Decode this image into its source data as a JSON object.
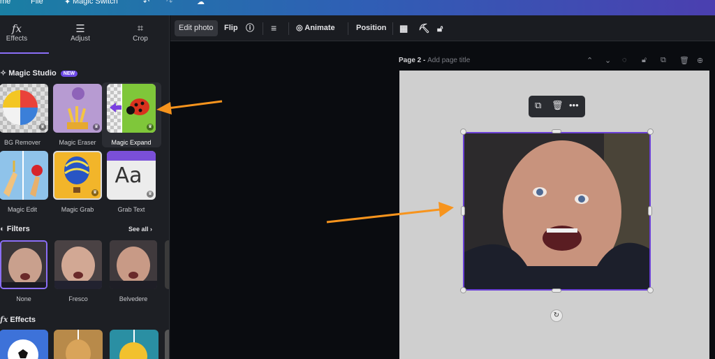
{
  "topbar": {
    "home": "me",
    "file": "File",
    "magic_switch": "Magic Switch"
  },
  "tabs": [
    {
      "label": "Effects",
      "icon": "fx-icon"
    },
    {
      "label": "Adjust",
      "icon": "sliders-icon"
    },
    {
      "label": "Crop",
      "icon": "crop-icon"
    }
  ],
  "magic_studio": {
    "title": "Magic Studio",
    "badge": "NEW",
    "items": [
      {
        "label": "BG Remover"
      },
      {
        "label": "Magic Eraser"
      },
      {
        "label": "Magic Expand"
      },
      {
        "label": "Magic Edit"
      },
      {
        "label": "Magic Grab"
      },
      {
        "label": "Grab Text"
      }
    ]
  },
  "filters": {
    "title": "Filters",
    "see_all": "See all",
    "items": [
      {
        "label": "None"
      },
      {
        "label": "Fresco"
      },
      {
        "label": "Belvedere"
      }
    ]
  },
  "effects": {
    "title": "Effects"
  },
  "toolbar": {
    "edit_photo": "Edit photo",
    "flip": "Flip",
    "animate": "Animate",
    "position": "Position"
  },
  "page": {
    "label": "Page 2 - ",
    "placeholder": "Add page title"
  },
  "grab_text_glyph": "Aa",
  "colors": {
    "accent": "#8b6ef7",
    "selection": "#6a3fd6",
    "arrow": "#f7941d"
  }
}
